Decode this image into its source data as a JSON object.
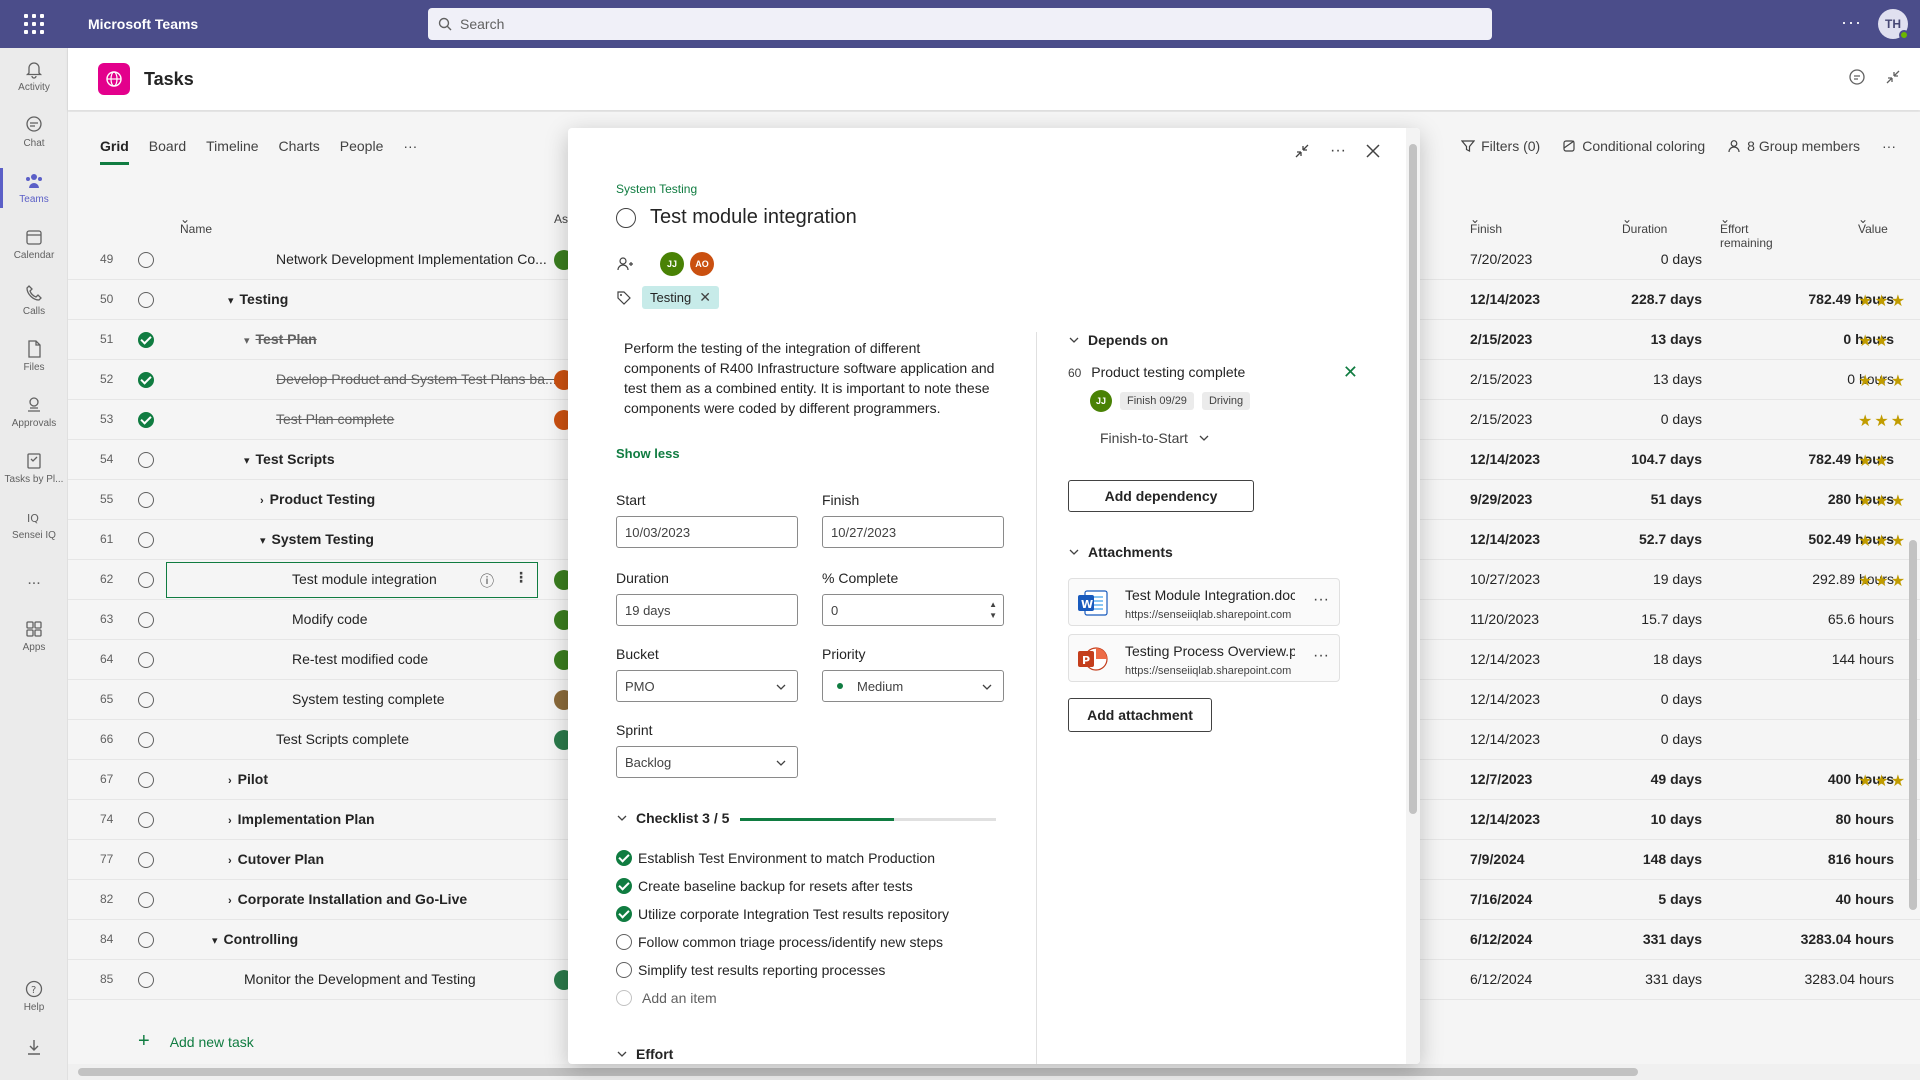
{
  "app": {
    "name": "Microsoft Teams",
    "search_placeholder": "Search",
    "user_initials": "TH"
  },
  "rail": {
    "items": [
      {
        "label": "Activity",
        "icon": "bell-icon"
      },
      {
        "label": "Chat",
        "icon": "chat-icon"
      },
      {
        "label": "Teams",
        "icon": "teams-icon",
        "active": true
      },
      {
        "label": "Calendar",
        "icon": "calendar-icon"
      },
      {
        "label": "Calls",
        "icon": "phone-icon"
      },
      {
        "label": "Files",
        "icon": "file-icon"
      },
      {
        "label": "Approvals",
        "icon": "approvals-icon"
      },
      {
        "label": "Tasks by Pl...",
        "icon": "tasks-icon"
      },
      {
        "label": "Sensei IQ",
        "icon": "iq-icon"
      },
      {
        "label": "...",
        "icon": "more-icon"
      },
      {
        "label": "Apps",
        "icon": "apps-icon"
      }
    ],
    "help": "Help"
  },
  "tasks": {
    "title": "Tasks",
    "views": [
      "Grid",
      "Board",
      "Timeline",
      "Charts",
      "People",
      "···"
    ],
    "toolbar": {
      "filters": "Filters (0)",
      "conditional": "Conditional coloring",
      "members": "8 Group members"
    },
    "columns": {
      "name": "Name",
      "assigned": "As",
      "finish": "Finish",
      "duration": "Duration",
      "effort": "Effort remaining",
      "value": "Value"
    },
    "rows": [
      {
        "num": "49",
        "name": "Network Development Implementation Co...",
        "indent": 2,
        "done": false,
        "finish": "7/20/2023",
        "duration": "0 days",
        "effort": "",
        "stars": "",
        "bold": false,
        "av": "#3a7d1f"
      },
      {
        "num": "50",
        "name": "Testing",
        "indent": 0,
        "expanded": true,
        "done": false,
        "finish": "12/14/2023",
        "duration": "228.7 days",
        "effort": "782.49 hours",
        "stars": "★★★",
        "bold": true
      },
      {
        "num": "51",
        "name": "Test Plan",
        "indent": 1,
        "expanded": true,
        "done": true,
        "strike": true,
        "finish": "2/15/2023",
        "duration": "13 days",
        "effort": "0 hours",
        "stars": "★★",
        "bold": true
      },
      {
        "num": "52",
        "name": "Develop Product and System Test Plans ba...",
        "indent": 2,
        "done": true,
        "strike": true,
        "finish": "2/15/2023",
        "duration": "13 days",
        "effort": "0 hours",
        "stars": "★★★",
        "bold": false,
        "av": "#ca5010"
      },
      {
        "num": "53",
        "name": "Test Plan complete",
        "indent": 2,
        "done": true,
        "strike": true,
        "finish": "2/15/2023",
        "duration": "0 days",
        "effort": "",
        "stars": "★★★",
        "bold": false,
        "av": "#ca5010"
      },
      {
        "num": "54",
        "name": "Test Scripts",
        "indent": 1,
        "expanded": true,
        "done": false,
        "finish": "12/14/2023",
        "duration": "104.7 days",
        "effort": "782.49 hours",
        "stars": "★★",
        "bold": true
      },
      {
        "num": "55",
        "name": "Product Testing",
        "indent": 2,
        "collapsed": true,
        "done": false,
        "finish": "9/29/2023",
        "duration": "51 days",
        "effort": "280 hours",
        "stars": "★★★",
        "bold": true
      },
      {
        "num": "61",
        "name": "System Testing",
        "indent": 2,
        "expanded": true,
        "done": false,
        "finish": "12/14/2023",
        "duration": "52.7 days",
        "effort": "502.49 hours",
        "stars": "★★★",
        "bold": true
      },
      {
        "num": "62",
        "name": "Test module integration",
        "indent": 3,
        "done": false,
        "selected": true,
        "finish": "10/27/2023",
        "duration": "19 days",
        "effort": "292.89 hours",
        "stars": "★★★",
        "bold": false,
        "av": "#3a7d1f"
      },
      {
        "num": "63",
        "name": "Modify code",
        "indent": 3,
        "done": false,
        "finish": "11/20/2023",
        "duration": "15.7 days",
        "effort": "65.6 hours",
        "stars": "",
        "bold": false,
        "av": "#3a7d1f"
      },
      {
        "num": "64",
        "name": "Re-test modified code",
        "indent": 3,
        "done": false,
        "finish": "12/14/2023",
        "duration": "18 days",
        "effort": "144 hours",
        "stars": "",
        "bold": false,
        "av": "#3a7d1f"
      },
      {
        "num": "65",
        "name": "System testing complete",
        "indent": 3,
        "done": false,
        "finish": "12/14/2023",
        "duration": "0 days",
        "effort": "",
        "stars": "",
        "bold": false,
        "av": "#8a6a3a"
      },
      {
        "num": "66",
        "name": "Test Scripts complete",
        "indent": 2,
        "done": false,
        "finish": "12/14/2023",
        "duration": "0 days",
        "effort": "",
        "stars": "",
        "bold": false,
        "av": "#2b7a4b"
      },
      {
        "num": "67",
        "name": "Pilot",
        "indent": 0,
        "collapsed": true,
        "done": false,
        "finish": "12/7/2023",
        "duration": "49 days",
        "effort": "400 hours",
        "stars": "★★★",
        "bold": true
      },
      {
        "num": "74",
        "name": "Implementation Plan",
        "indent": 0,
        "collapsed": true,
        "done": false,
        "finish": "12/14/2023",
        "duration": "10 days",
        "effort": "80 hours",
        "stars": "",
        "bold": true
      },
      {
        "num": "77",
        "name": "Cutover Plan",
        "indent": 0,
        "collapsed": true,
        "done": false,
        "finish": "7/9/2024",
        "duration": "148 days",
        "effort": "816 hours",
        "stars": "",
        "bold": true
      },
      {
        "num": "82",
        "name": "Corporate Installation and Go-Live",
        "indent": 0,
        "collapsed": true,
        "done": false,
        "finish": "7/16/2024",
        "duration": "5 days",
        "effort": "40 hours",
        "stars": "",
        "bold": true
      },
      {
        "num": "84",
        "name": "Controlling",
        "indent": -1,
        "expanded": true,
        "done": false,
        "finish": "6/12/2024",
        "duration": "331 days",
        "effort": "3283.04 hours",
        "stars": "",
        "bold": true
      },
      {
        "num": "85",
        "name": "Monitor the Development and Testing",
        "indent": 0,
        "done": false,
        "finish": "6/12/2024",
        "duration": "331 days",
        "effort": "3283.04 hours",
        "stars": "",
        "bold": false,
        "av": "#2b7a4b"
      }
    ],
    "add_new_task": "Add new task"
  },
  "modal": {
    "bucket_label": "System Testing",
    "title": "Test module integration",
    "assignees": [
      {
        "initials": "JJ",
        "color": "#498205"
      },
      {
        "initials": "AO",
        "color": "#ca5010"
      }
    ],
    "label": "Testing",
    "description": "Perform the testing of the integration of different components of R400 Infrastructure software application and test them as a combined entity. It is important to note these components were coded by different programmers.",
    "show_less": "Show less",
    "start_label": "Start",
    "start_value": "10/03/2023",
    "finish_label": "Finish",
    "finish_value": "10/27/2023",
    "duration_label": "Duration",
    "duration_value": "19 days",
    "complete_label": "% Complete",
    "complete_value": "0",
    "bucket_field_label": "Bucket",
    "bucket_value": "PMO",
    "priority_label": "Priority",
    "priority_value": "Medium",
    "sprint_label": "Sprint",
    "sprint_value": "Backlog",
    "checklist": {
      "title": "Checklist 3 / 5",
      "progress": 0.6,
      "items": [
        {
          "text": "Establish Test Environment to match Production",
          "done": true
        },
        {
          "text": "Create baseline backup for resets after tests",
          "done": true
        },
        {
          "text": "Utilize corporate Integration Test results repository",
          "done": true
        },
        {
          "text": "Follow common triage process/identify new steps",
          "done": false
        },
        {
          "text": "Simplify test results reporting processes",
          "done": false
        }
      ],
      "add_item": "Add an item"
    },
    "effort_title": "Effort",
    "depends": {
      "title": "Depends on",
      "num": "60",
      "task": "Product testing complete",
      "assignee": "JJ",
      "finish": "Finish 09/29",
      "driving": "Driving",
      "type": "Finish-to-Start",
      "add_button": "Add dependency"
    },
    "attachments": {
      "title": "Attachments",
      "items": [
        {
          "name": "Test Module Integration.docx",
          "url": "https://senseiiqlab.sharepoint.com",
          "kind": "word"
        },
        {
          "name": "Testing Process Overview.pptx",
          "url": "https://senseiiqlab.sharepoint.com",
          "kind": "ppt"
        }
      ],
      "add_button": "Add attachment"
    }
  }
}
